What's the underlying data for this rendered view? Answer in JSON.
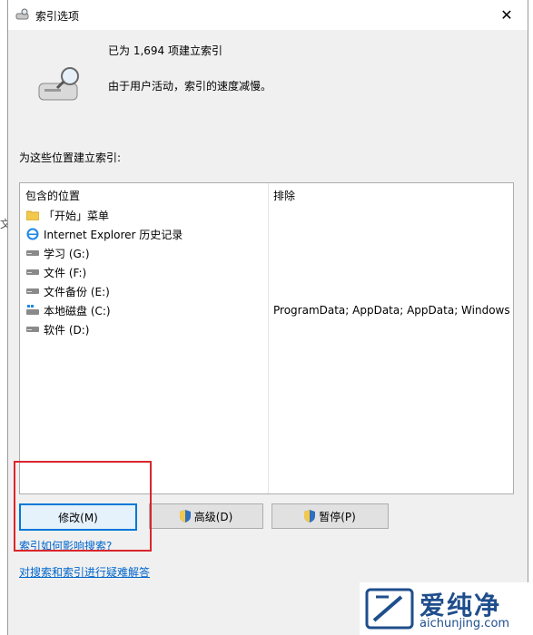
{
  "window": {
    "title": "索引选项",
    "close_glyph": "✕"
  },
  "status": {
    "indexed": "已为 1,694 项建立索引",
    "speed_note": "由于用户活动，索引的速度减慢。"
  },
  "section_label": "为这些位置建立索引:",
  "table": {
    "col_included": "包含的位置",
    "col_excluded": "排除",
    "rows": [
      {
        "icon": "folder-icon",
        "label": "「开始」菜单",
        "excluded": ""
      },
      {
        "icon": "ie-icon",
        "label": "Internet Explorer 历史记录",
        "excluded": ""
      },
      {
        "icon": "drive-icon",
        "label": "学习 (G:)",
        "excluded": ""
      },
      {
        "icon": "drive-icon",
        "label": "文件 (F:)",
        "excluded": ""
      },
      {
        "icon": "drive-icon",
        "label": "文件备份 (E:)",
        "excluded": ""
      },
      {
        "icon": "system-drive-icon",
        "label": "本地磁盘 (C:)",
        "excluded": "ProgramData; AppData; AppData; Windows"
      },
      {
        "icon": "drive-icon",
        "label": "软件 (D:)",
        "excluded": ""
      }
    ]
  },
  "buttons": {
    "modify": "修改(M)",
    "advanced": "高级(D)",
    "pause": "暂停(P)"
  },
  "links": {
    "how_affects": "索引如何影响搜索?",
    "troubleshoot": "对搜索和索引进行疑难解答"
  },
  "watermark": {
    "brand": "爱纯净",
    "url": "aichunjing.com"
  },
  "colors": {
    "highlight": "#d9262d",
    "link": "#0066cc",
    "accent": "#0078d7"
  }
}
